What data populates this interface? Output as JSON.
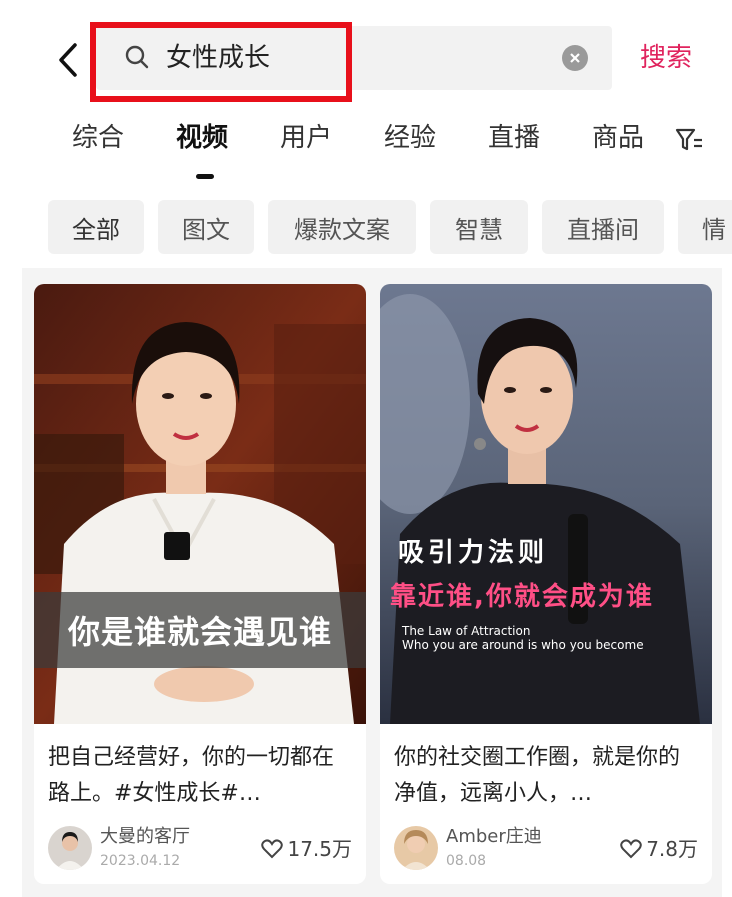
{
  "header": {
    "search_query": "女性成长",
    "search_button": "搜索"
  },
  "tabs": [
    {
      "label": "综合",
      "active": false
    },
    {
      "label": "视频",
      "active": true
    },
    {
      "label": "用户",
      "active": false
    },
    {
      "label": "经验",
      "active": false
    },
    {
      "label": "直播",
      "active": false
    },
    {
      "label": "商品",
      "active": false
    }
  ],
  "chips": [
    "全部",
    "图文",
    "爆款文案",
    "智慧",
    "直播间",
    "情"
  ],
  "cards": [
    {
      "overlay_text": "你是谁就会遇见谁",
      "title": "把自己经营好，你的一切都在路上。#女性成长#…",
      "author": "大曼的客厅",
      "date": "2023.04.12",
      "likes": "17.5万"
    },
    {
      "overlay_line1": "吸引力法则",
      "overlay_line2": "靠近谁,你就会成为谁",
      "overlay_line3": "The Law of Attraction",
      "overlay_line4": "Who you are around is who you become",
      "title": "你的社交圈工作圈，就是你的净值，远离小人，…",
      "author": "Amber庄迪",
      "date": "08.08",
      "likes": "7.8万"
    }
  ],
  "colors": {
    "accent": "#e0245e",
    "highlight_border": "#e8101b"
  }
}
